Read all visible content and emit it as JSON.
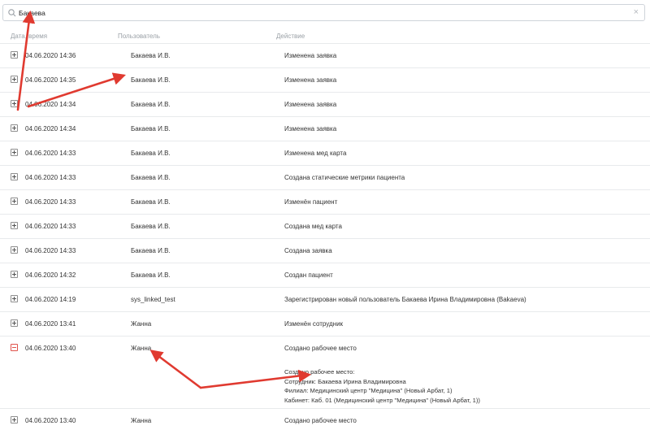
{
  "search": {
    "value": "Бакаева",
    "placeholder": ""
  },
  "columns": {
    "date": "Дата, время",
    "user": "Пользователь",
    "action": "Действие"
  },
  "rows": [
    {
      "date": "04.06.2020 14:36",
      "user": "Бакаева И.В.",
      "action": "Изменена заявка",
      "toggle": "plus"
    },
    {
      "date": "04.06.2020 14:35",
      "user": "Бакаева И.В.",
      "action": "Изменена заявка",
      "toggle": "plus"
    },
    {
      "date": "04.06.2020 14:34",
      "user": "Бакаева И.В.",
      "action": "Изменена заявка",
      "toggle": "plus"
    },
    {
      "date": "04.06.2020 14:34",
      "user": "Бакаева И.В.",
      "action": "Изменена заявка",
      "toggle": "plus"
    },
    {
      "date": "04.06.2020 14:33",
      "user": "Бакаева И.В.",
      "action": "Изменена мед карта",
      "toggle": "plus"
    },
    {
      "date": "04.06.2020 14:33",
      "user": "Бакаева И.В.",
      "action": "Создана статические метрики пациента",
      "toggle": "plus"
    },
    {
      "date": "04.06.2020 14:33",
      "user": "Бакаева И.В.",
      "action": "Изменён пациент",
      "toggle": "plus"
    },
    {
      "date": "04.06.2020 14:33",
      "user": "Бакаева И.В.",
      "action": "Создана мед карта",
      "toggle": "plus"
    },
    {
      "date": "04.06.2020 14:33",
      "user": "Бакаева И.В.",
      "action": "Создана заявка",
      "toggle": "plus"
    },
    {
      "date": "04.06.2020 14:32",
      "user": "Бакаева И.В.",
      "action": "Создан пациент",
      "toggle": "plus"
    },
    {
      "date": "04.06.2020 14:19",
      "user": "sys_linked_test",
      "action": "Зарегистрирован новый пользователь Бакаева Ирина Владимировна (Bakaeva)",
      "toggle": "plus"
    },
    {
      "date": "04.06.2020 13:41",
      "user": "Жанна",
      "action": "Изменён сотрудник",
      "toggle": "plus"
    },
    {
      "date": "04.06.2020 13:40",
      "user": "Жанна",
      "action": "Создано рабочее место",
      "toggle": "minus",
      "details": [
        "Создано рабочее место:",
        "Сотрудник: Бакаева Ирина Владимировна",
        "Филиал: Медицинский центр \"Медицина\" (Новый Арбат, 1)",
        "Кабинет: Каб. 01 (Медицинский центр \"Медицина\" (Новый Арбат, 1))"
      ]
    },
    {
      "date": "04.06.2020 13:40",
      "user": "Жанна",
      "action": "Создано рабочее место",
      "toggle": "plus"
    }
  ],
  "icons": {
    "search": "search-icon",
    "clear": "close-icon",
    "expand": "plus-square-icon",
    "collapse": "minus-square-icon"
  },
  "colors": {
    "annotation_arrow": "#e03a30",
    "collapse_toggle": "#e0534c",
    "header_text": "#9aa0a6",
    "divider": "#e8eaec"
  }
}
